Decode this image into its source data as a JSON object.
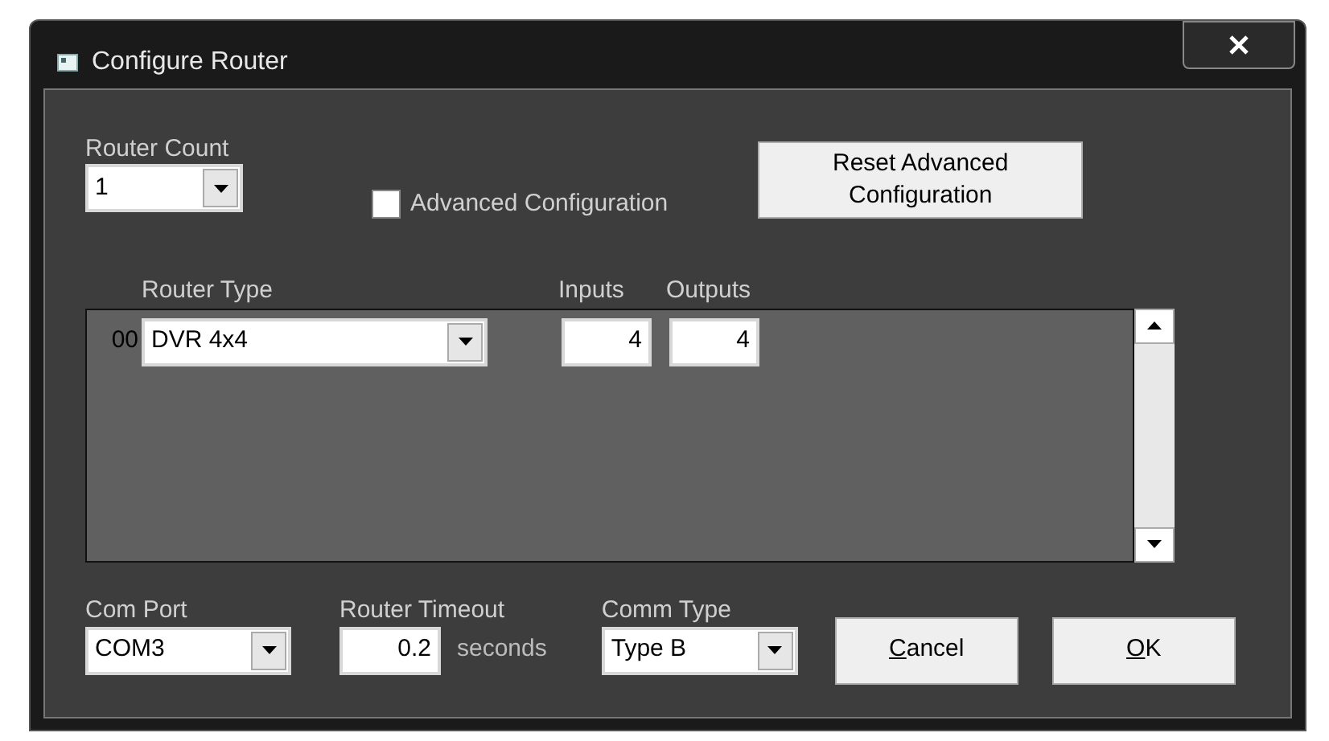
{
  "window": {
    "title": "Configure Router"
  },
  "router_count": {
    "label": "Router Count",
    "value": "1"
  },
  "advanced_configuration": {
    "label": "Advanced Configuration",
    "checked": false
  },
  "reset_button": {
    "label": "Reset Advanced Configuration"
  },
  "routers": {
    "columns": [
      "Router Type",
      "Inputs",
      "Outputs"
    ],
    "rows": [
      {
        "index": "00",
        "type": "DVR 4x4",
        "inputs": "4",
        "outputs": "4"
      }
    ]
  },
  "com_port": {
    "label": "Com Port",
    "value": "COM3"
  },
  "router_timeout": {
    "label": "Router Timeout",
    "value": "0.2",
    "unit": "seconds"
  },
  "comm_type": {
    "label": "Comm Type",
    "value": "Type B"
  },
  "buttons": [
    {
      "label": "Cancel",
      "accelerator_underlined": true
    },
    {
      "label": "OK",
      "accelerator_underlined": true
    }
  ]
}
